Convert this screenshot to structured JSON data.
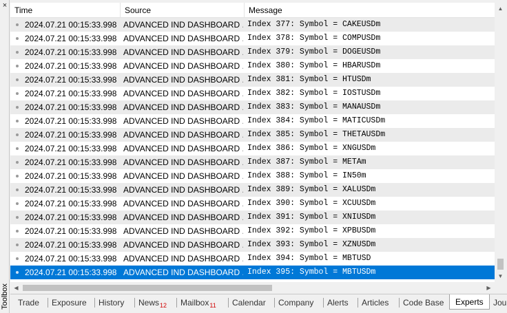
{
  "toolbox": {
    "label": "Toolbox",
    "close_glyph": "×"
  },
  "columns": {
    "time": "Time",
    "source": "Source",
    "message": "Message"
  },
  "rows": [
    {
      "time": "2024.07.21 00:15:33.998",
      "source": "ADVANCED IND DASHBOARD ...",
      "message": "Index 377: Symbol = CAKEUSDm"
    },
    {
      "time": "2024.07.21 00:15:33.998",
      "source": "ADVANCED IND DASHBOARD ...",
      "message": "Index 378: Symbol = COMPUSDm"
    },
    {
      "time": "2024.07.21 00:15:33.998",
      "source": "ADVANCED IND DASHBOARD ...",
      "message": "Index 379: Symbol = DOGEUSDm"
    },
    {
      "time": "2024.07.21 00:15:33.998",
      "source": "ADVANCED IND DASHBOARD ...",
      "message": "Index 380: Symbol = HBARUSDm"
    },
    {
      "time": "2024.07.21 00:15:33.998",
      "source": "ADVANCED IND DASHBOARD ...",
      "message": "Index 381: Symbol = HTUSDm"
    },
    {
      "time": "2024.07.21 00:15:33.998",
      "source": "ADVANCED IND DASHBOARD ...",
      "message": "Index 382: Symbol = IOSTUSDm"
    },
    {
      "time": "2024.07.21 00:15:33.998",
      "source": "ADVANCED IND DASHBOARD ...",
      "message": "Index 383: Symbol = MANAUSDm"
    },
    {
      "time": "2024.07.21 00:15:33.998",
      "source": "ADVANCED IND DASHBOARD ...",
      "message": "Index 384: Symbol = MATICUSDm"
    },
    {
      "time": "2024.07.21 00:15:33.998",
      "source": "ADVANCED IND DASHBOARD ...",
      "message": "Index 385: Symbol = THETAUSDm"
    },
    {
      "time": "2024.07.21 00:15:33.998",
      "source": "ADVANCED IND DASHBOARD ...",
      "message": "Index 386: Symbol = XNGUSDm"
    },
    {
      "time": "2024.07.21 00:15:33.998",
      "source": "ADVANCED IND DASHBOARD ...",
      "message": "Index 387: Symbol = METAm"
    },
    {
      "time": "2024.07.21 00:15:33.998",
      "source": "ADVANCED IND DASHBOARD ...",
      "message": "Index 388: Symbol = IN50m"
    },
    {
      "time": "2024.07.21 00:15:33.998",
      "source": "ADVANCED IND DASHBOARD ...",
      "message": "Index 389: Symbol = XALUSDm"
    },
    {
      "time": "2024.07.21 00:15:33.998",
      "source": "ADVANCED IND DASHBOARD ...",
      "message": "Index 390: Symbol = XCUUSDm"
    },
    {
      "time": "2024.07.21 00:15:33.998",
      "source": "ADVANCED IND DASHBOARD ...",
      "message": "Index 391: Symbol = XNIUSDm"
    },
    {
      "time": "2024.07.21 00:15:33.998",
      "source": "ADVANCED IND DASHBOARD ...",
      "message": "Index 392: Symbol = XPBUSDm"
    },
    {
      "time": "2024.07.21 00:15:33.998",
      "source": "ADVANCED IND DASHBOARD ...",
      "message": "Index 393: Symbol = XZNUSDm"
    },
    {
      "time": "2024.07.21 00:15:33.998",
      "source": "ADVANCED IND DASHBOARD ...",
      "message": "Index 394: Symbol = MBTUSD"
    },
    {
      "time": "2024.07.21 00:15:33.998",
      "source": "ADVANCED IND DASHBOARD ...",
      "message": "Index 395: Symbol = MBTUSDm",
      "selected": true
    }
  ],
  "tabs": [
    {
      "label": "Trade"
    },
    {
      "label": "Exposure"
    },
    {
      "label": "History"
    },
    {
      "label": "News",
      "badge": "12"
    },
    {
      "label": "Mailbox",
      "badge": "11"
    },
    {
      "label": "Calendar"
    },
    {
      "label": "Company"
    },
    {
      "label": "Alerts"
    },
    {
      "label": "Articles"
    },
    {
      "label": "Code Base"
    },
    {
      "label": "Experts",
      "active": true
    },
    {
      "label": "Jou"
    }
  ],
  "colors": {
    "selection": "#0078d7",
    "alt_row": "#ebebeb",
    "badge": "#d00000"
  }
}
